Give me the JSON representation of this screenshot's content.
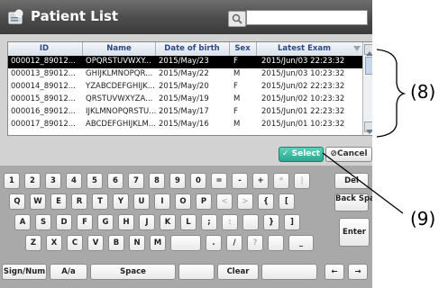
{
  "header": {
    "title": "Patient List",
    "search_placeholder": ""
  },
  "list": {
    "columns": [
      "ID",
      "Name",
      "Date of birth",
      "Sex",
      "Latest Exam"
    ],
    "rows": [
      {
        "id": "000012_89012...",
        "name": "OPQRSTUVWXY...",
        "dob": "2015/May/23",
        "sex": "F",
        "exam": "2015/Jun/03 22:23:32"
      },
      {
        "id": "000013_89012...",
        "name": "GHIJKLMNOPQR...",
        "dob": "2015/May/22",
        "sex": "M",
        "exam": "2015/Jun/03 10:23:32"
      },
      {
        "id": "000014_89012...",
        "name": "YZABCDEFGHIJK...",
        "dob": "2015/May/20",
        "sex": "F",
        "exam": "2015/Jun/02 22:23:32"
      },
      {
        "id": "000015_89012...",
        "name": "QRSTUVWXYZA...",
        "dob": "2015/May/19",
        "sex": "M",
        "exam": "2015/Jun/02 10:23:32"
      },
      {
        "id": "000016_89012...",
        "name": "IJKLMNOPQRSTU...",
        "dob": "2015/May/17",
        "sex": "F",
        "exam": "2015/Jun/01 22:23:32"
      },
      {
        "id": "000017_89012...",
        "name": "ABCDEFGHIJKLM...",
        "dob": "2015/May/16",
        "sex": "M",
        "exam": "2015/Jun/01 10:23:32"
      }
    ]
  },
  "actions": {
    "select_label": "Select",
    "cancel_label": "Cancel"
  },
  "keyboard": {
    "row1": [
      "1",
      "2",
      "3",
      "4",
      "5",
      "6",
      "7",
      "8",
      "9",
      "0",
      "=",
      "-",
      "+",
      "*",
      "|",
      "Del"
    ],
    "row2": [
      "Q",
      "W",
      "E",
      "R",
      "T",
      "Y",
      "U",
      "I",
      "O",
      "P",
      "<",
      ">",
      "{",
      "[",
      "Back Space"
    ],
    "row3": [
      "A",
      "S",
      "D",
      "F",
      "G",
      "H",
      "J",
      "K",
      "L",
      ";",
      ":",
      "",
      "}",
      "]",
      "Enter"
    ],
    "row4": [
      "Z",
      "X",
      "C",
      "V",
      "B",
      "N",
      "M",
      "",
      ".",
      "/",
      "?",
      "",
      "_"
    ],
    "row5": [
      "Sign/Num",
      "A/a",
      "Space",
      "",
      "Clear",
      "",
      "←",
      "→"
    ]
  },
  "callouts": {
    "list_callout": "(8)",
    "select_callout": "(9)"
  },
  "colors": {
    "header": "#4b4b4b",
    "selected_row": "#000000",
    "select_button": "#2aa890",
    "keyboard_bg": "#a9a9a9"
  }
}
